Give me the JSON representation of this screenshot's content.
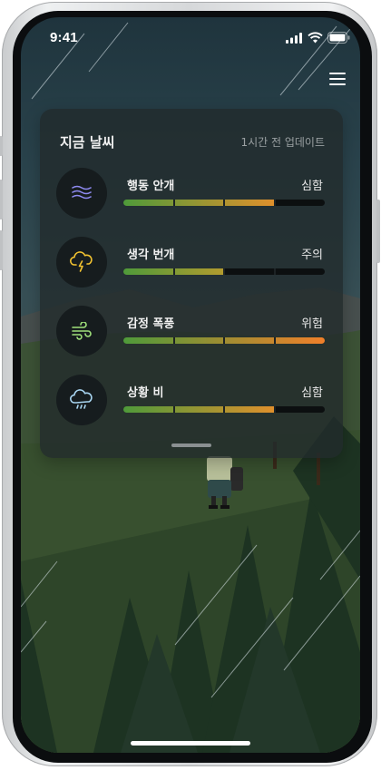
{
  "status_bar": {
    "time": "9:41"
  },
  "weather_card": {
    "title": "지금 날씨",
    "updated": "1시간 전 업데이트",
    "rows": [
      {
        "icon": "fog-icon",
        "label": "행동 안개",
        "level": "심함",
        "fill": 0.75,
        "bar_color": "#e0902c"
      },
      {
        "icon": "thunder-cloud-icon",
        "label": "생각 번개",
        "level": "주의",
        "fill": 0.5,
        "bar_color": "#b39b2e"
      },
      {
        "icon": "wind-icon",
        "label": "감정 폭풍",
        "level": "위험",
        "fill": 1.0,
        "bar_color": "#f0802a"
      },
      {
        "icon": "rain-cloud-icon",
        "label": "상황 비",
        "level": "심함",
        "fill": 0.75,
        "bar_color": "#e0902c"
      }
    ]
  },
  "colors": {
    "bar_start": "#4f9a3a",
    "bar_track": "#0c0f10",
    "fog_icon": "#8e8af0",
    "thunder_icon": "#f2c230",
    "wind_icon": "#9fe07a",
    "rain_icon": "#a9d6f2"
  }
}
